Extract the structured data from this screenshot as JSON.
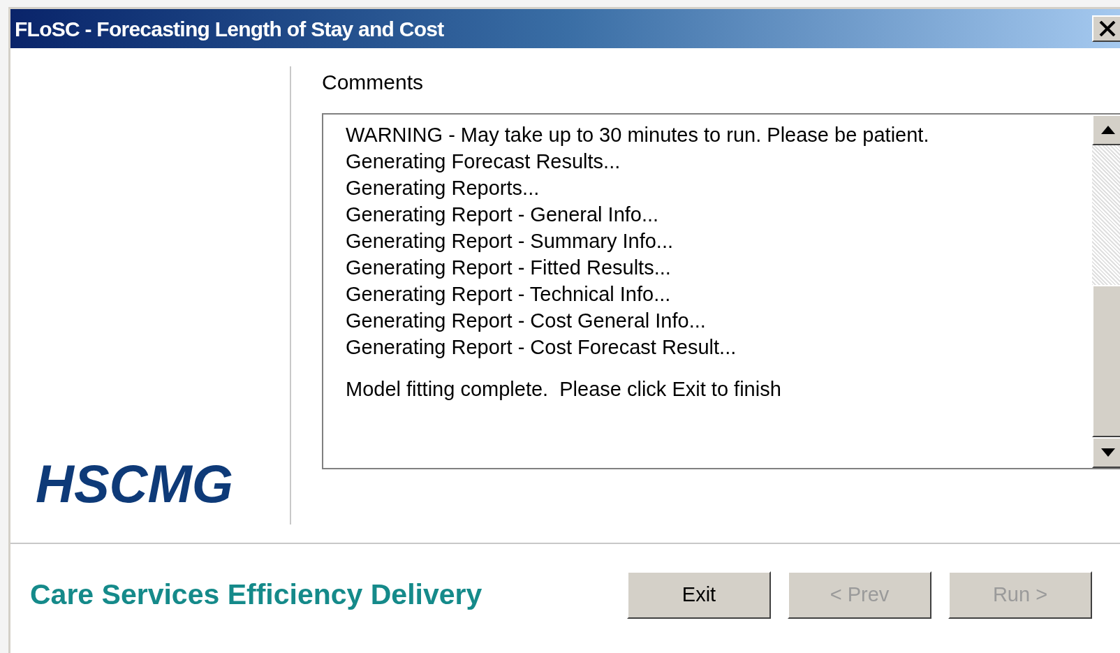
{
  "window": {
    "title": "FLoSC - Forecasting Length of Stay and Cost"
  },
  "logo": "HSCMG",
  "comments": {
    "label": "Comments",
    "lines": [
      "WARNING - May take up to 30 minutes to run. Please be patient.",
      "Generating Forecast Results...",
      "Generating Reports...",
      "Generating Report - General Info...",
      "Generating Report - Summary Info...",
      "Generating Report - Fitted Results...",
      "Generating Report - Technical Info...",
      "Generating Report - Cost General Info...",
      "Generating Report - Cost Forecast Result..."
    ],
    "final_message": "Model fitting complete.  Please click Exit to finish"
  },
  "footer": {
    "tagline": "Care Services Efficiency Delivery",
    "buttons": [
      {
        "label": "Exit",
        "disabled": false
      },
      {
        "label": "< Prev",
        "disabled": true
      },
      {
        "label": "Run >",
        "disabled": true
      }
    ]
  }
}
